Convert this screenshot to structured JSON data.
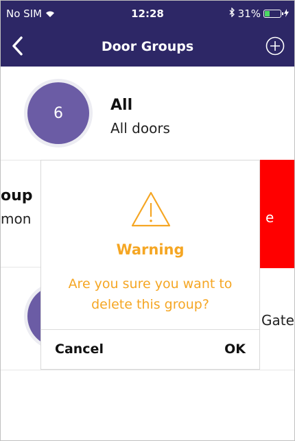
{
  "status_bar": {
    "carrier": "No SIM",
    "time": "12:28",
    "battery": "31%"
  },
  "nav": {
    "title": "Door Groups"
  },
  "rows": [
    {
      "count": "6",
      "name": "All",
      "desc": "All doors"
    },
    {
      "name": "oup",
      "desc": "mon",
      "action": "e"
    },
    {
      "desc": "Gate"
    }
  ],
  "dialog": {
    "title": "Warning",
    "message": "Are you sure you want to delete this group?",
    "cancel": "Cancel",
    "ok": "OK"
  },
  "colors": {
    "nav_bg": "#2d2766",
    "avatar": "#6b5ca5",
    "warning": "#f5a623",
    "delete": "#ff0000"
  }
}
